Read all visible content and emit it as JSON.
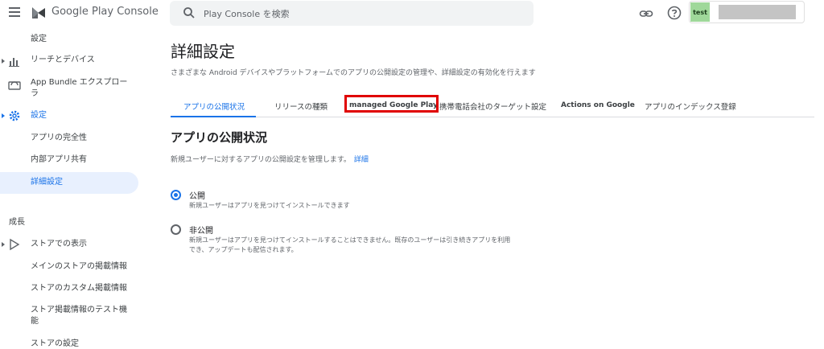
{
  "app": {
    "name": "Google Play Console",
    "search_placeholder": "Play Console を検索",
    "account_avatar_text": "test"
  },
  "sidebar": {
    "items": [
      {
        "label": "設定"
      },
      {
        "label": "リーチとデバイス"
      },
      {
        "label": "App Bundle エクスプローラ"
      },
      {
        "label": "設定"
      },
      {
        "label": "アプリの完全性"
      },
      {
        "label": "内部アプリ共有"
      },
      {
        "label": "詳細設定"
      },
      {
        "label": "ストアでの表示"
      },
      {
        "label": "メインのストアの掲載情報"
      },
      {
        "label": "ストアのカスタム掲載情報"
      },
      {
        "label": "ストア掲載情報のテスト機能"
      },
      {
        "label": "ストアの設定"
      }
    ],
    "section_growth": "成長"
  },
  "main": {
    "title": "詳細設定",
    "description": "さまざまな Android デバイスやプラットフォームでのアプリの公開設定の管理や、詳細設定の有効化を行えます",
    "tabs": [
      {
        "label": "アプリの公開状況"
      },
      {
        "label": "リリースの種類"
      },
      {
        "label": "managed Google Play"
      },
      {
        "label": "携帯電話会社のターゲット設定"
      },
      {
        "label": "Actions on Google"
      },
      {
        "label": "アプリのインデックス登録"
      }
    ],
    "section_title": "アプリの公開状況",
    "section_description": "新規ユーザーに対するアプリの公開設定を管理します。",
    "learn_more": "詳細",
    "options": [
      {
        "label": "公開",
        "description": "新規ユーザーはアプリを見つけてインストールできます",
        "checked": true
      },
      {
        "label": "非公開",
        "description": "新規ユーザーはアプリを見つけてインストールすることはできません。既存のユーザーは引き続きアプリを利用でき、アップデートも配信されます。",
        "checked": false
      }
    ]
  },
  "colors": {
    "accent": "#1a73e8",
    "highlight": "#e00000",
    "selected_bg": "#e8f0fe"
  }
}
